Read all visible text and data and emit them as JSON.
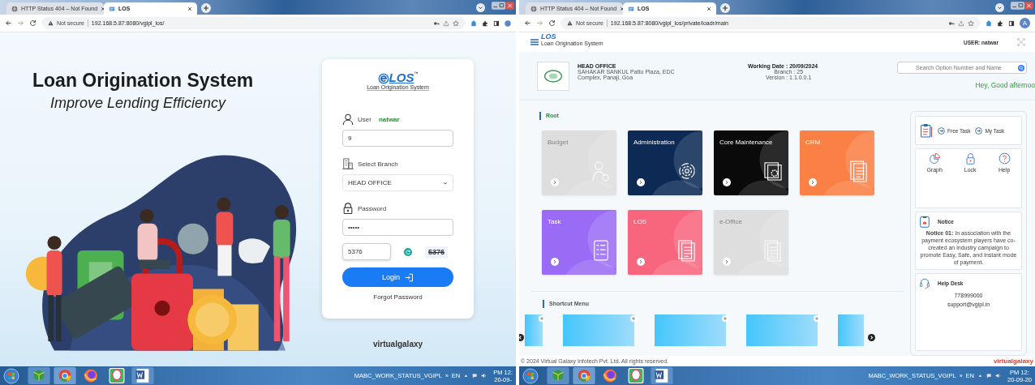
{
  "screens": [
    {
      "kind": "login",
      "browser": {
        "tabs": [
          {
            "title": "HTTP Status 404 – Not Found",
            "selected": false
          },
          {
            "title": "LOS",
            "selected": true
          }
        ],
        "security": "Not secure",
        "url": "192.168.5.87:8080/vgipl_los/"
      },
      "hero": {
        "title": "Loan Origination System",
        "subtitle": "Improve Lending Efficiency"
      },
      "login_card": {
        "logo": "LOS",
        "logo_mark": "™",
        "logo_caption": "Loan Origination System",
        "user_label": "User",
        "user_name": "natwar",
        "user_value": "9",
        "branch_label": "Select Branch",
        "branch_value": "HEAD OFFICE",
        "password_label": "Password",
        "password_value": "•••••",
        "captcha_value": "5376",
        "captcha_image": "5376",
        "login_button": "Login",
        "forgot_link": "Forgot Password"
      },
      "brand": "virtualgalaxy",
      "taskbar": {
        "tray_label": "MABC_WORK_STATUS_VGIPL",
        "overflow": "»",
        "language": "EN",
        "time": "PM 12:",
        "date": "20-09-"
      }
    },
    {
      "kind": "dashboard",
      "browser": {
        "tabs": [
          {
            "title": "HTTP Status 404 – Not Found",
            "selected": false
          },
          {
            "title": "LOS",
            "selected": true
          }
        ],
        "security": "Not secure",
        "url": "192.168.5.87:8080/vgipl_los/private/loadr/main",
        "profile": "A"
      },
      "header": {
        "logo": "LOS",
        "logo_caption": "Loan Origination System",
        "user": "USER: natwar"
      },
      "office": {
        "name": "HEAD OFFICE",
        "address": "SAHAKAR SANKUL Patto Plaza, EDC Complex, Panaji, Goa",
        "working_date": "Working Date : 20/09/2024",
        "branch": "Branch : 25",
        "version": "Version : 1.1.0.0.1"
      },
      "search": {
        "placeholder": "Search Option Number and Name"
      },
      "greeting": "Hey, Good afternoo",
      "root": {
        "title": "Root",
        "tiles": [
          {
            "label": "Budget",
            "color": "#dcdee1",
            "disabled": true
          },
          {
            "label": "Administration",
            "color": "#0d2a55",
            "disabled": false
          },
          {
            "label": "Core Maintenance",
            "color": "#0a0a0a",
            "disabled": false
          },
          {
            "label": "CRM",
            "color": "#fb8045",
            "disabled": false
          },
          {
            "label": "Task",
            "color": "#9a6cf5",
            "disabled": false
          },
          {
            "label": "LOS",
            "color": "#f8667e",
            "disabled": false
          },
          {
            "label": "e-Office",
            "color": "#dcdee1",
            "disabled": true
          }
        ]
      },
      "shortcut_menu": {
        "title": "Shortcut Menu"
      },
      "footer": "© 2024 Virtual Galaxy Infotech Pvt. Ltd. All rights reserved.",
      "side_panel": {
        "task_links": [
          "Free Task",
          "My Task"
        ],
        "tools": [
          "Graph",
          "Lock",
          "Help"
        ],
        "notice": {
          "title": "Notice",
          "text": "**Notice 01:** In association with the payment ecosystem players have co-created an industry campaign to promote Easy, Safe, and Instant mode of payment."
        },
        "help_desk": {
          "title": "Help Desk",
          "phone": "778999000",
          "email": "support@vgipl.in"
        },
        "brand": "virtualgalaxy"
      },
      "taskbar": {
        "tray_label": "MABC_WORK_STATUS_VGIPL",
        "overflow": "»",
        "language": "EN",
        "time": "PM 12:",
        "date": "20-09-20"
      }
    }
  ]
}
